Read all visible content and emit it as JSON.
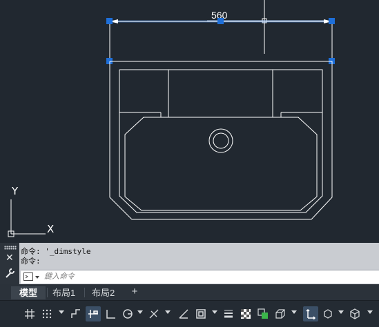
{
  "drawing": {
    "dimension_text": "560",
    "ucs_x_label": "X",
    "ucs_y_label": "Y"
  },
  "command_line": {
    "history": [
      "命令: '_dimstyle",
      "命令:"
    ],
    "input_placeholder": "鍵入命令",
    "input_value": ""
  },
  "layout_tabs": [
    {
      "label": "模型",
      "active": true
    },
    {
      "label": "布局1",
      "active": false
    },
    {
      "label": "布局2",
      "active": false
    }
  ],
  "add_tab_label": "+",
  "status_bar": {
    "buttons": [
      {
        "icon": "grid-icon",
        "on": false
      },
      {
        "icon": "snap-grid-icon",
        "on": false
      },
      {
        "icon": "infer-constraints-icon",
        "on": false
      },
      {
        "icon": "dynamic-input-icon",
        "on": true
      },
      {
        "icon": "ortho-icon",
        "on": false
      },
      {
        "icon": "polar-tracking-icon",
        "on": false
      },
      {
        "icon": "isometric-drafting-icon",
        "on": false
      },
      {
        "icon": "object-snap-tracking-icon",
        "on": false
      },
      {
        "icon": "object-snap-icon",
        "on": false
      },
      {
        "icon": "lineweight-icon",
        "on": false
      },
      {
        "icon": "transparency-icon",
        "on": false
      },
      {
        "icon": "selection-cycling-icon",
        "on": false
      },
      {
        "icon": "3d-object-snap-icon",
        "on": false
      },
      {
        "icon": "annotation-scale-icon",
        "on": true
      },
      {
        "icon": "workspace-icon",
        "on": false
      },
      {
        "icon": "isolate-objects-icon",
        "on": false
      }
    ]
  },
  "colors": {
    "canvas_bg": "#212830",
    "drawing_lines": "#ffffff",
    "grip_blue": "#1e6fd9",
    "dimension_line": "#4d8fe6"
  }
}
